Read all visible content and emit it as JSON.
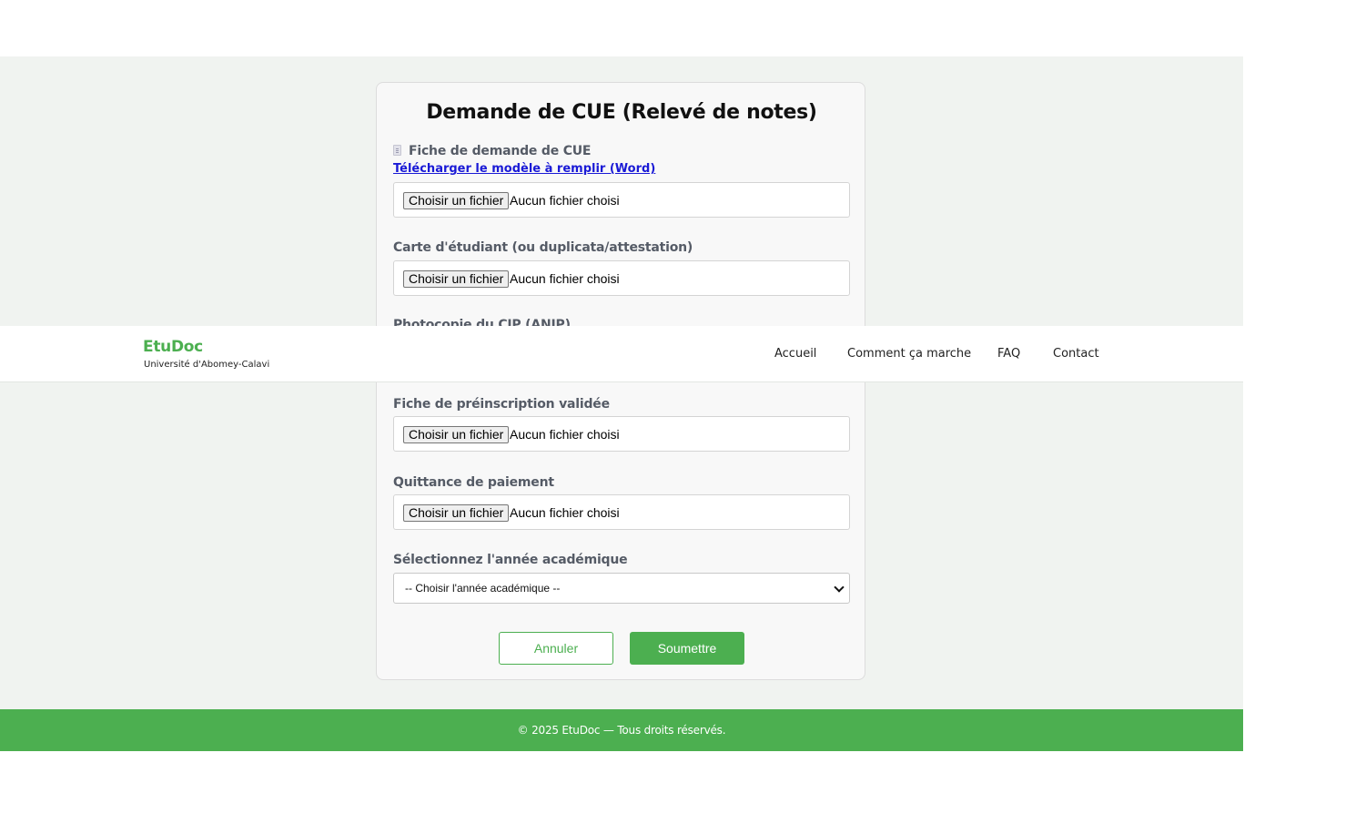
{
  "header": {
    "brand": "EtuDoc",
    "subtitle": "Université d'Abomey-Calavi",
    "nav": [
      "Accueil",
      "Comment ça marche",
      "FAQ",
      "Contact"
    ]
  },
  "form": {
    "title": "Demande de CUE (Relevé de notes)",
    "template_label": "Fiche de demande de CUE",
    "template_link": "Télécharger le modèle à remplir (Word)",
    "file_button_label": "Choisir un fichier",
    "file_status": "Aucun fichier choisi",
    "fields": [
      {
        "label": "Carte d'étudiant (ou duplicata/attestation)"
      },
      {
        "label": "Photocopie du CIP (ANIP)"
      },
      {
        "label": "Fiche de préinscription validée"
      },
      {
        "label": "Quittance de paiement"
      }
    ],
    "year_label": "Sélectionnez l'année académique",
    "year_placeholder": "-- Choisir l'année académique --",
    "cancel_label": "Annuler",
    "submit_label": "Soumettre"
  },
  "footer": {
    "text": "© 2025 EtuDoc — Tous droits réservés."
  },
  "colors": {
    "accent": "#4caf50",
    "page_background": "#f0f3f0",
    "link": "#1a1ad6"
  }
}
